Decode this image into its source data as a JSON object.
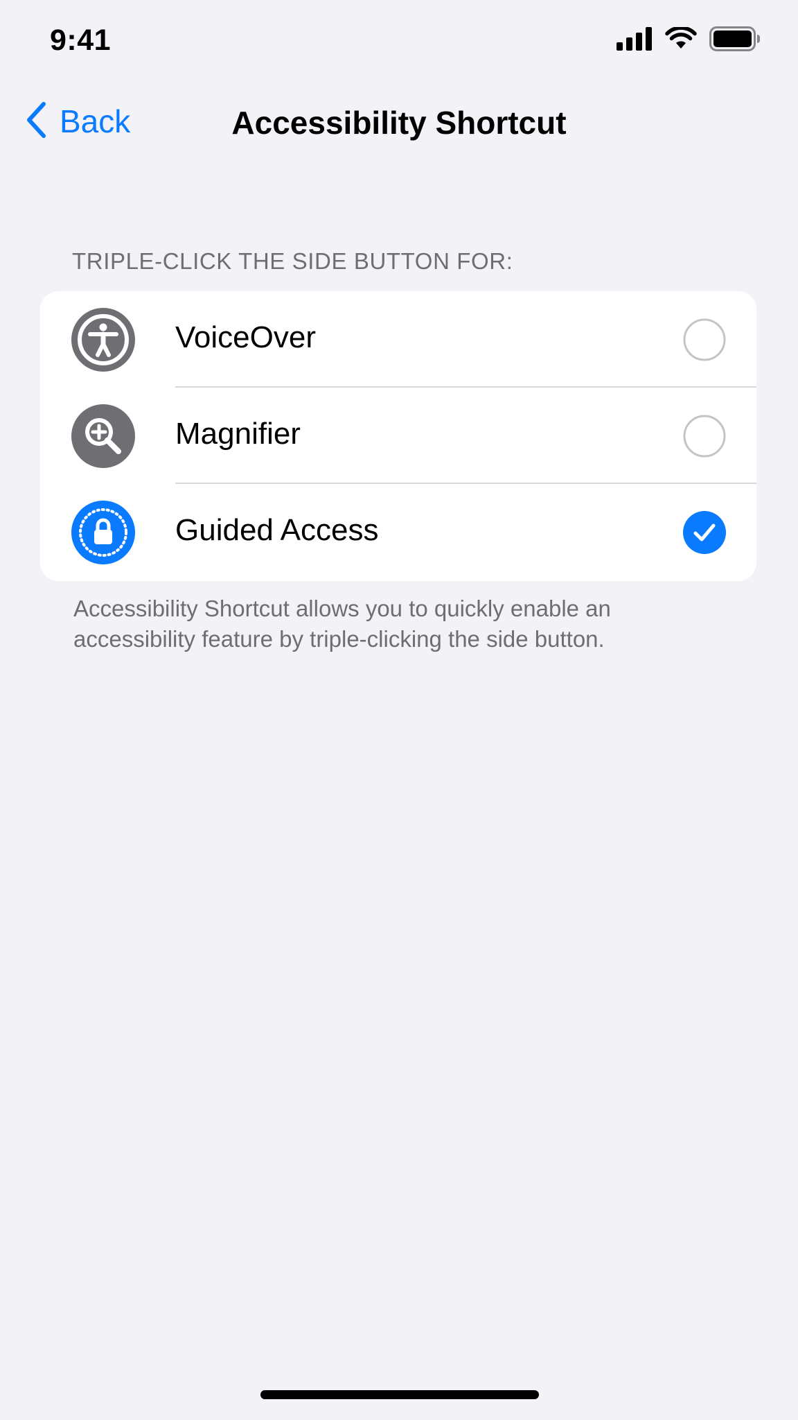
{
  "status_bar": {
    "time": "9:41",
    "icons": [
      "cellular-signal-icon",
      "wifi-icon",
      "battery-icon"
    ]
  },
  "nav": {
    "back_label": "Back",
    "back_icon": "chevron-left-icon",
    "title": "Accessibility Shortcut"
  },
  "section": {
    "header": "TRIPLE-CLICK THE SIDE BUTTON FOR:",
    "footer": "Accessibility Shortcut allows you to quickly enable an accessibility feature by triple-clicking the side button."
  },
  "options": [
    {
      "label": "VoiceOver",
      "icon": "accessibility-person-icon",
      "icon_color": "#6e6e73",
      "selected": false
    },
    {
      "label": "Magnifier",
      "icon": "magnifier-icon",
      "icon_color": "#6e6e73",
      "selected": false
    },
    {
      "label": "Guided Access",
      "icon": "guided-access-lock-icon",
      "icon_color": "#0a7aff",
      "selected": true
    }
  ],
  "colors": {
    "accent": "#0a7aff",
    "background": "#f2f2f7",
    "secondary_text": "#6d6d72",
    "gray_icon": "#6e6e73"
  }
}
